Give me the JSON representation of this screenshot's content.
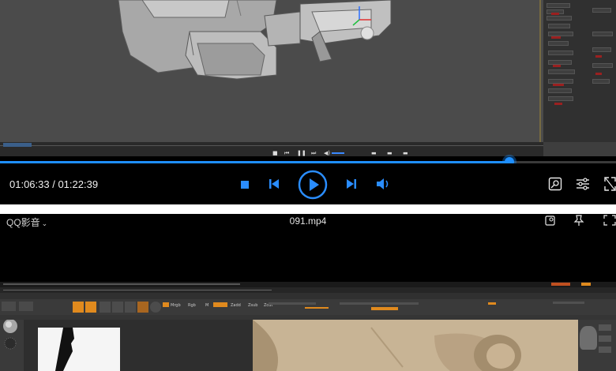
{
  "top_player": {
    "current_time": "01:06:33",
    "separator": " / ",
    "total_time": "01:22:39",
    "progress_fraction": 0.827,
    "icons": {
      "stop": "stop-icon",
      "prev": "skip-previous-icon",
      "play": "play-icon",
      "next": "skip-next-icon",
      "volume": "volume-icon",
      "screenshot": "screenshot-icon",
      "settings": "equalizer-icon",
      "fullscreen": "fullscreen-icon"
    },
    "accent_color": "#1e8fff"
  },
  "bottom_player": {
    "app_name": "QQ影音",
    "file_name": "091.mp4",
    "icons": {
      "app_menu": "chevron-down-icon",
      "screenshot": "screenshot-icon",
      "pin": "pin-icon",
      "fullscreen": "fullscreen-icon"
    }
  },
  "zbrush": {
    "tool_values": [
      "Mrgb",
      "Rgb",
      "M",
      "Zadd",
      "Zsub",
      "Zcut"
    ],
    "accent_color": "#e08a1e"
  }
}
